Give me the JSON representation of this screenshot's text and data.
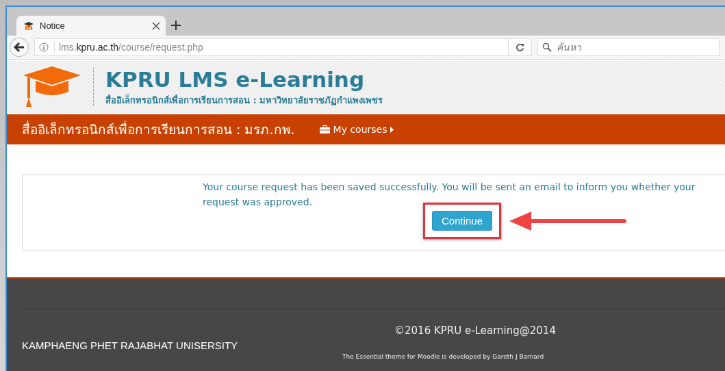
{
  "browser": {
    "tab": {
      "title": "Notice",
      "selected": true
    },
    "url": {
      "subdomain": "lms.",
      "domain": "kpru.ac.th",
      "path": "/course/request.php"
    },
    "search": {
      "placeholder": "ค้นหา"
    }
  },
  "header": {
    "title": "KPRU LMS e-Learning",
    "subtitle": "สื่ออิเล็กทรอนิกส์เพื่อการเรียนการสอน : มหาวิทยาลัยราชภัฏกำแพงเพชร"
  },
  "navbar": {
    "brand": "สื่ออิเล็กทรอนิกส์เพื่อการเรียนการสอน : มรภ.กพ.",
    "menu": "My courses"
  },
  "notice": {
    "message": "Your course request has been saved successfully. You will be sent an email to inform you whether your request was approved.",
    "button": "Continue"
  },
  "footer": {
    "copyright": "©2016 KPRU e-Learning@2014",
    "university": "KAMPHAENG PHET RAJABHAT UNISERSITY",
    "credit": "The Essential theme for Moodle is developed by Gareth J Barnard"
  }
}
